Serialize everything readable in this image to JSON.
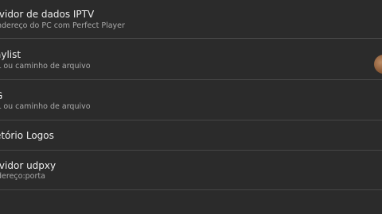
{
  "settings": {
    "items": [
      {
        "title": "rvidor de dados IPTV",
        "subtitle": "ndereço do PC com Perfect Player"
      },
      {
        "title": "aylist",
        "subtitle": "L ou caminho de arquivo"
      },
      {
        "title": "G",
        "subtitle": "L ou caminho de arquivo"
      },
      {
        "title": "etório Logos"
      },
      {
        "title": "rvidor udpxy",
        "subtitle": "dereço:porta"
      }
    ]
  }
}
